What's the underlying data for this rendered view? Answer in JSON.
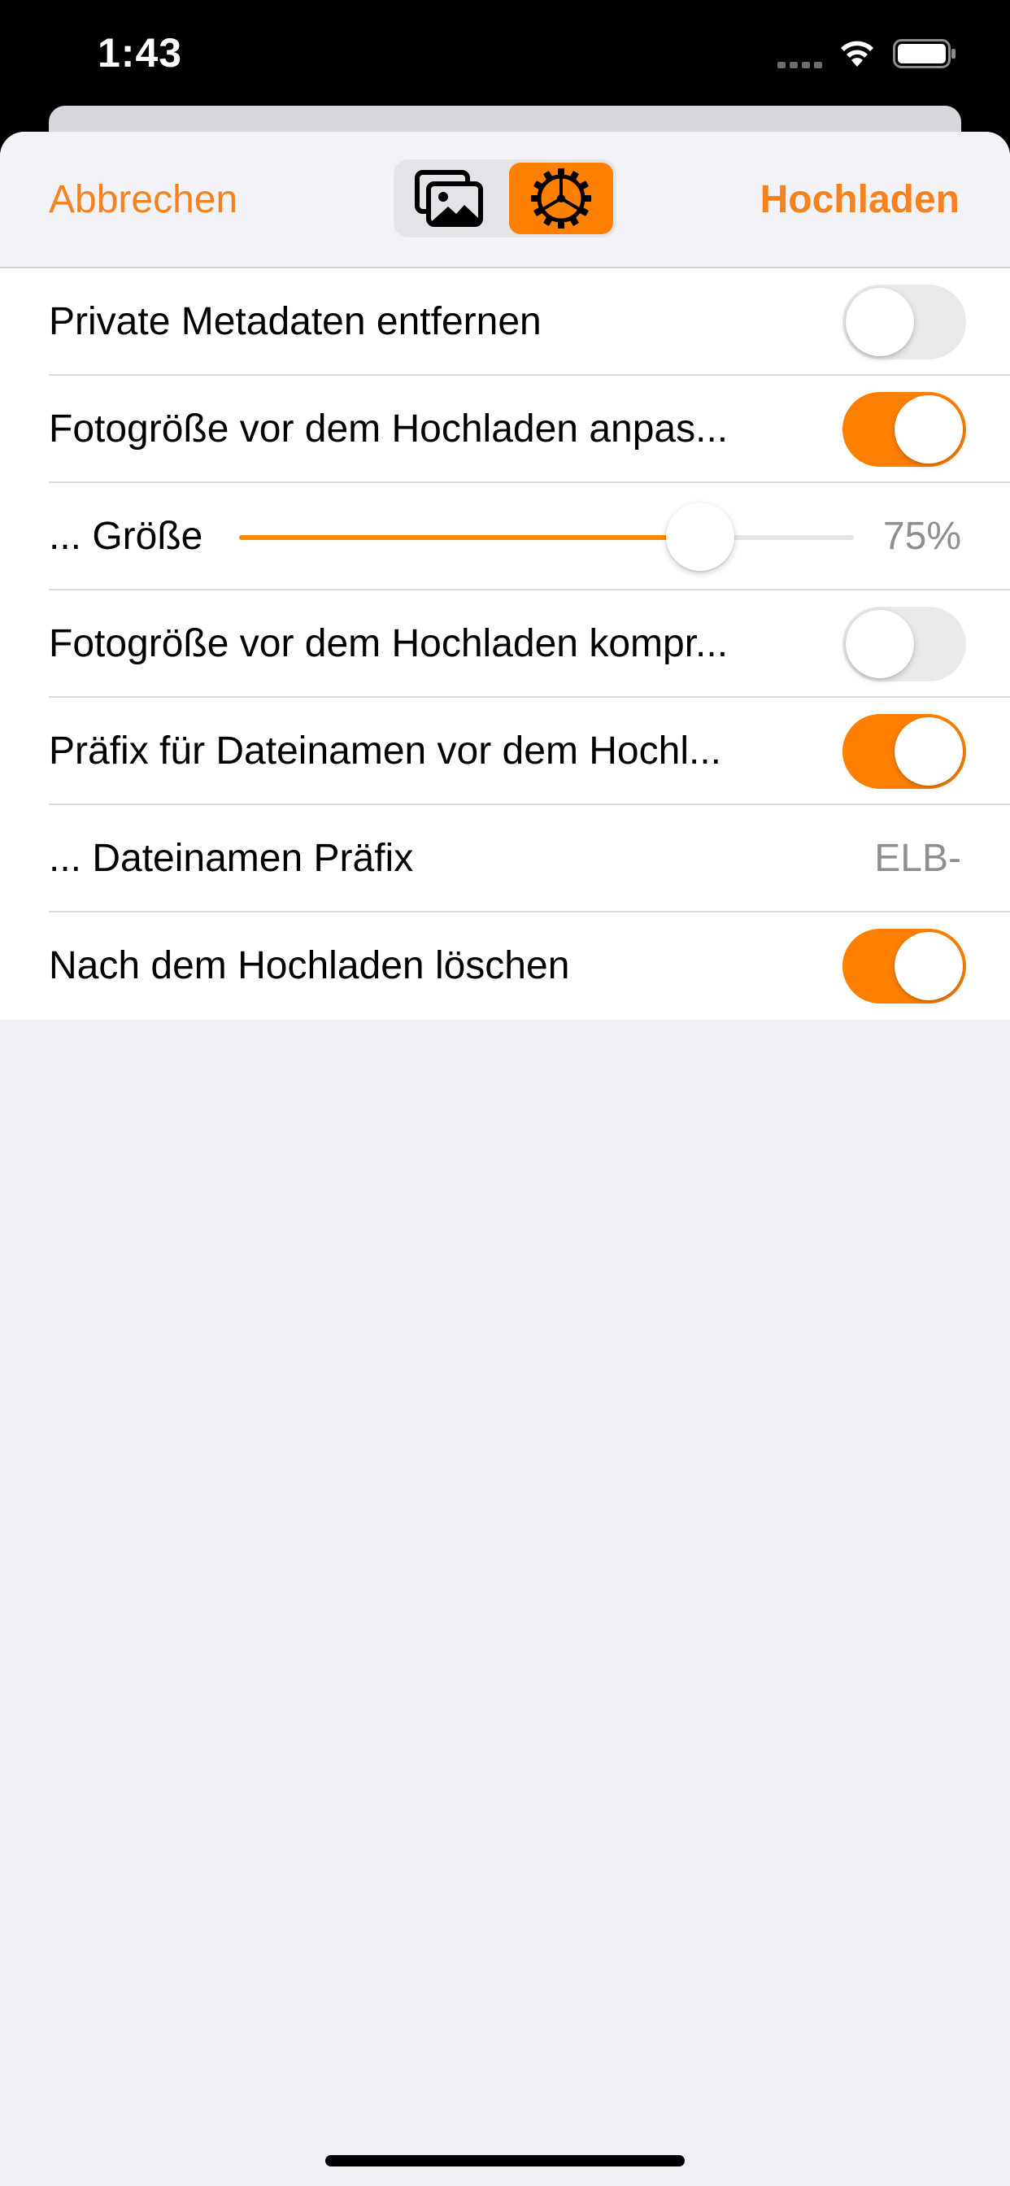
{
  "status_bar": {
    "time": "1:43"
  },
  "nav": {
    "cancel_label": "Abbrechen",
    "upload_label": "Hochladen",
    "segments": [
      {
        "icon": "photos-icon",
        "selected": false
      },
      {
        "icon": "gear-icon",
        "selected": true
      }
    ]
  },
  "settings": [
    {
      "label": "Private Metadaten entfernen",
      "type": "toggle",
      "on": false
    },
    {
      "label": "Fotogröße vor dem Hochladen anpas...",
      "type": "toggle",
      "on": true
    },
    {
      "label": "... Größe",
      "type": "slider",
      "value": 0.75,
      "display": "75%"
    },
    {
      "label": "Fotogröße vor dem Hochladen kompr...",
      "type": "toggle",
      "on": false
    },
    {
      "label": "Präfix für Dateinamen vor dem Hochl...",
      "type": "toggle",
      "on": true
    },
    {
      "label": "... Dateinamen Präfix",
      "type": "value",
      "value": "ELB-"
    },
    {
      "label": "Nach dem Hochladen löschen",
      "type": "toggle",
      "on": true
    }
  ],
  "colors": {
    "accent": "#ff7f00",
    "toggle_off": "#e9e9eb",
    "background": "#efeff4"
  }
}
